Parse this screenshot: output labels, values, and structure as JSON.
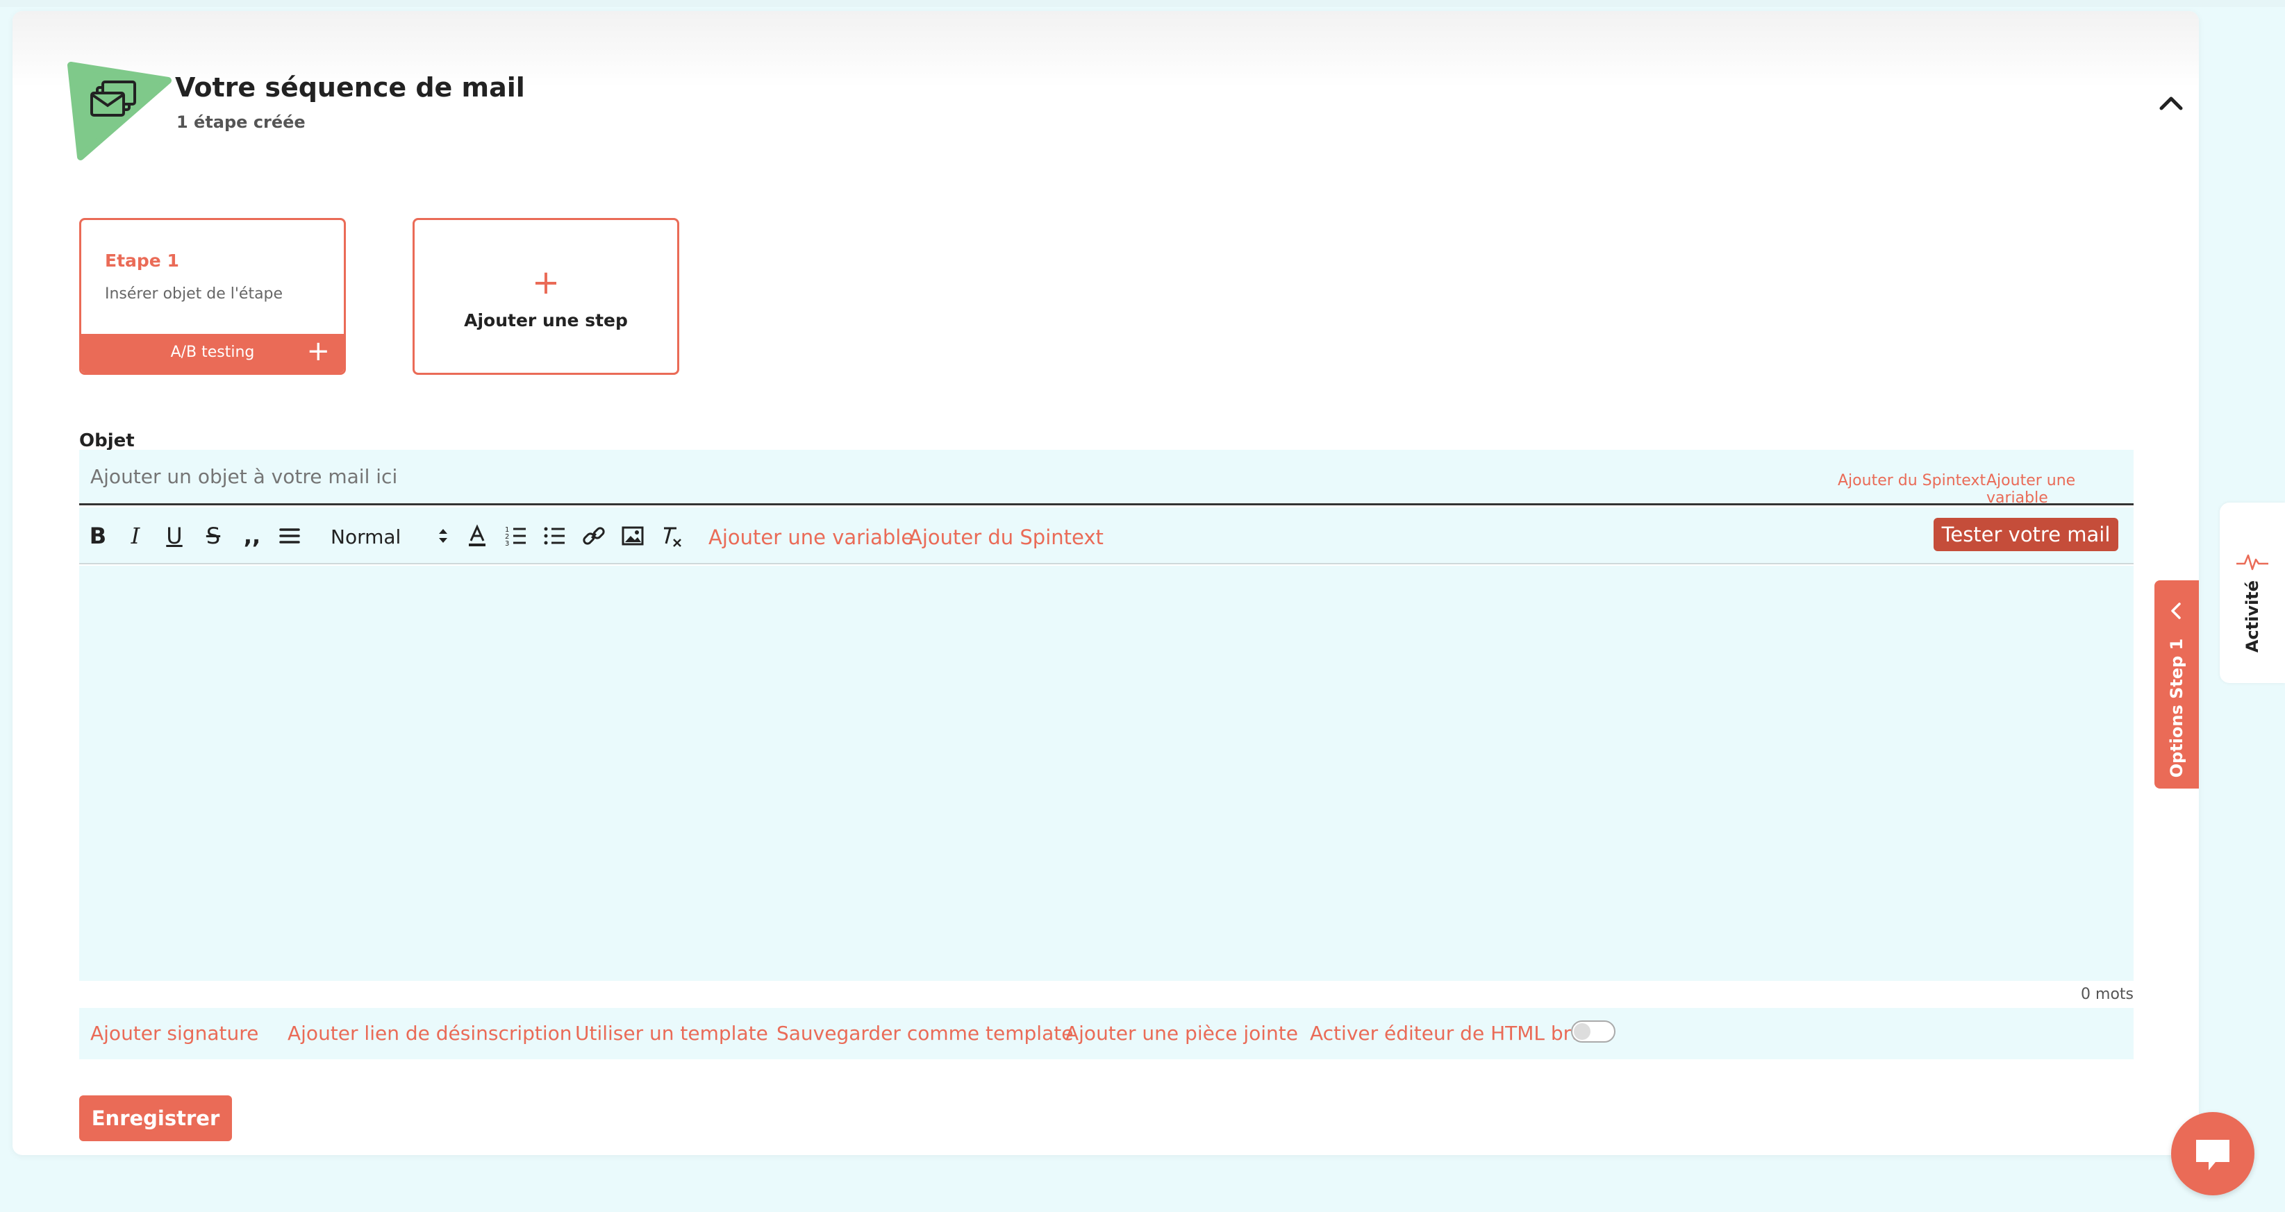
{
  "header": {
    "title": "Votre séquence de mail",
    "subtitle": "1 étape créée"
  },
  "steps": {
    "step1_title": "Etape 1",
    "step1_subtitle": "Insérer objet de l'étape",
    "step1_ab": "A/B testing",
    "add_plus": "+",
    "add_label": "Ajouter une step"
  },
  "object": {
    "label": "Objet",
    "placeholder": "Ajouter un objet à votre mail ici",
    "spintext_link": "Ajouter du Spintext",
    "variable_link": "Ajouter une variable"
  },
  "toolbar": {
    "format_value": "Normal",
    "variable_link": "Ajouter une variable",
    "spintext_link": "Ajouter du Spintext",
    "test_button": "Tester votre mail"
  },
  "editor": {
    "word_count": "0 mots"
  },
  "bottom_links": {
    "signature": "Ajouter signature",
    "unsubscribe": "Ajouter lien de désinscription",
    "use_template": "Utiliser un template",
    "save_template": "Sauvegarder comme template",
    "attachment": "Ajouter une pièce jointe",
    "html_editor": "Activer éditeur de HTML brut"
  },
  "save_button": "Enregistrer",
  "side": {
    "options_label": "Options Step 1",
    "activity_label": "Activité"
  },
  "colors": {
    "accent": "#ea6b57",
    "accent_dark": "#c54d3a",
    "editor_bg": "#eafafc",
    "logo_green": "#7fc98a"
  }
}
